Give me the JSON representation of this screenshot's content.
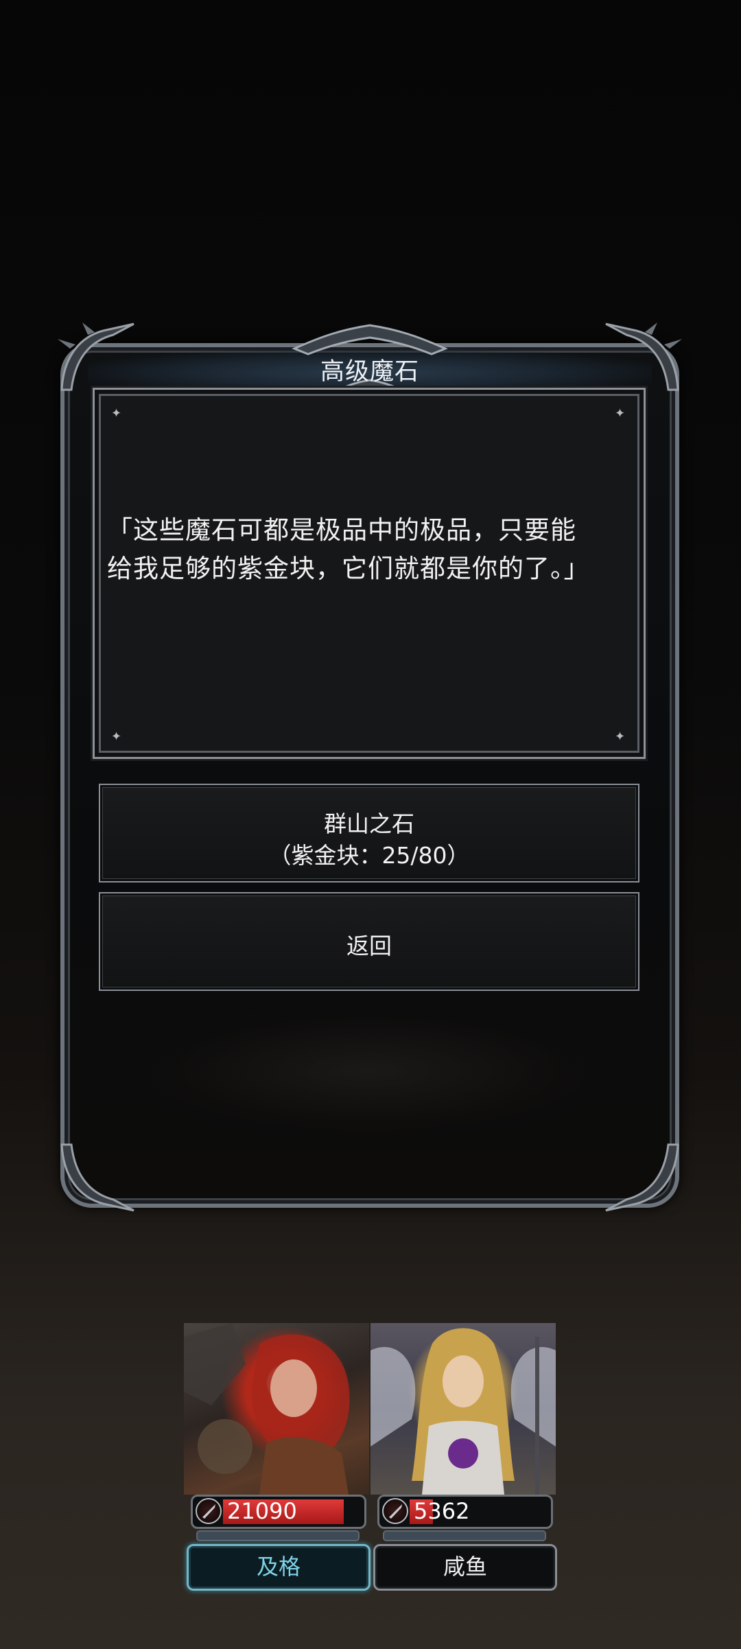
{
  "dialog": {
    "title": "高级魔石",
    "text": "「这些魔石可都是极品中的极品，只要能\n给我足够的紫金块，它们就都是你的了。」",
    "options": [
      {
        "label": "群山之石",
        "sub": "（紫金块：25/80）"
      },
      {
        "label": "返回"
      }
    ]
  },
  "party": [
    {
      "hp": "21090",
      "hp_fill": 0.88,
      "name": "及格",
      "selected": true,
      "hp_color": "#c82222"
    },
    {
      "hp": "5362",
      "hp_fill": 0.17,
      "name": "咸鱼",
      "selected": false,
      "hp_color": "#c82222"
    }
  ],
  "colors": {
    "frame": "#6d747c",
    "selected_name": "#7fd3e8",
    "text": "#f2f2f2"
  },
  "icons": {
    "hp": "sword-shield-icon",
    "corner": "sparkle-icon",
    "frame": "thorn-ornament-icon"
  }
}
